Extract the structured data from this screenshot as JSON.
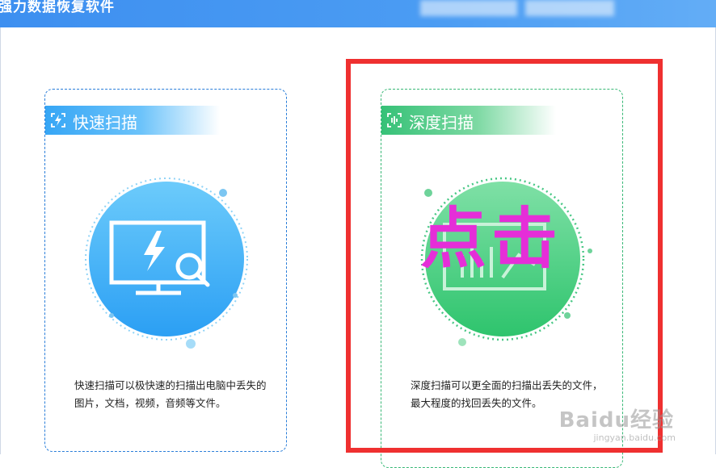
{
  "window": {
    "title": "强力数据恢复软件",
    "accent": "#4b9cf3"
  },
  "cards": [
    {
      "id": "quick",
      "title": "快速扫描",
      "description": "快速扫描可以极快速的扫描出电脑中丢失的图片，文档，视频，音频等文件。",
      "icon": "lightning-scan-icon",
      "illustration": "monitor-bolt-magnifier-icon",
      "color": "#36a6f5"
    },
    {
      "id": "deep",
      "title": "深度扫描",
      "description": "深度扫描可以更全面的扫描出丢失的文件，最大程度的找回丢失的文件。",
      "icon": "wave-scan-icon",
      "illustration": "monitor-chart-icon",
      "color": "#36c177"
    }
  ],
  "annotation": {
    "click_text": "点击",
    "text_color": "#e52ed8",
    "box_color": "#ef3030"
  },
  "watermark": {
    "logo": "Baidu经验",
    "site": "jingyan.baidu.com"
  }
}
